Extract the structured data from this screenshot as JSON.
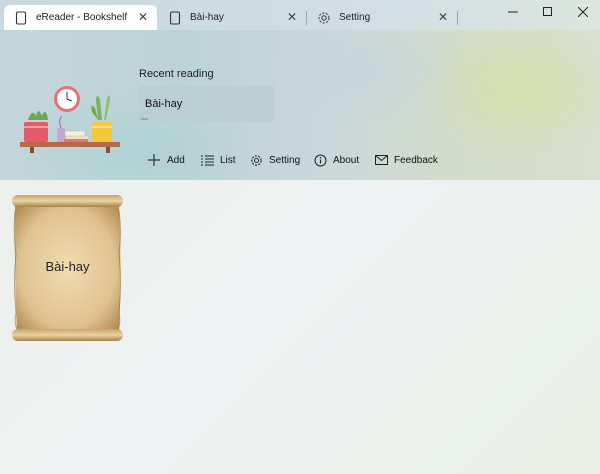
{
  "tabs": [
    {
      "label": "eReader - Bookshelf",
      "icon": "book-icon",
      "active": true
    },
    {
      "label": "Bài-hay",
      "icon": "book-icon",
      "active": false
    },
    {
      "label": "Setting",
      "icon": "gear-icon",
      "active": false
    }
  ],
  "window_controls": [
    "minimize-icon",
    "maximize-icon",
    "close-icon"
  ],
  "header": {
    "recent_label": "Recent reading",
    "recent_book": {
      "title": "Bài-hay",
      "progress": 0.05
    }
  },
  "toolbar": [
    {
      "label": "Add",
      "icon": "plus-icon"
    },
    {
      "label": "List",
      "icon": "list-icon"
    },
    {
      "label": "Setting",
      "icon": "gear-icon"
    },
    {
      "label": "About",
      "icon": "info-icon"
    },
    {
      "label": "Feedback",
      "icon": "mail-icon"
    }
  ],
  "bookshelf": {
    "books": [
      {
        "title": "Bài-hay"
      }
    ]
  },
  "colors": {
    "active_tab": "#ffffff",
    "scroll_paper": "#e2c99a",
    "scroll_edge": "#b08a4f"
  }
}
